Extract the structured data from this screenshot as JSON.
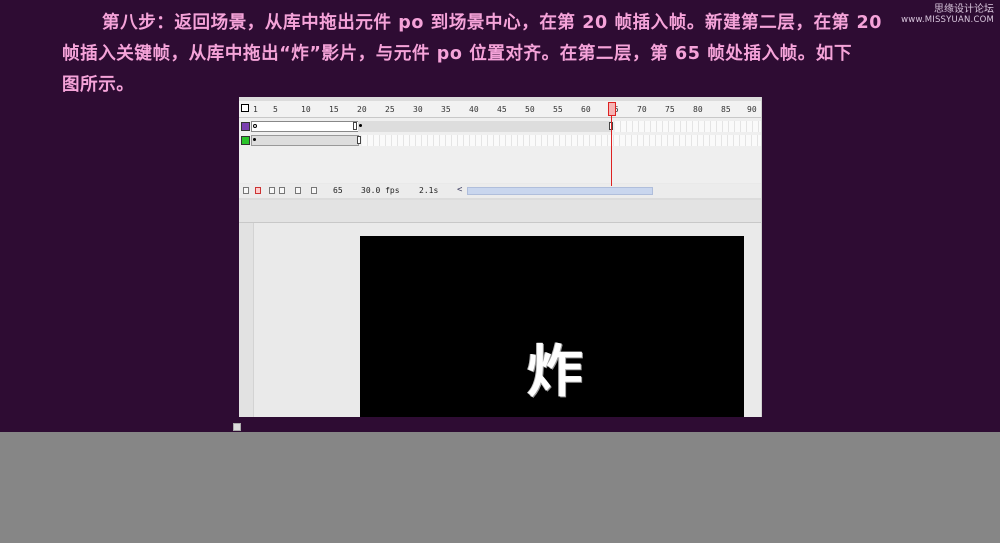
{
  "instructions": {
    "line1": "第八步：返回场景，从库中拖出元件 po 到场景中心，在第 20 帧插入帧。新建第二层，在第 20",
    "line2": "帧插入关键帧，从库中拖出“炸”影片，与元件 po 位置对齐。在第二层，第 65 帧处插入帧。如下",
    "line3": "图所示。"
  },
  "watermark": {
    "title": "思缘设计论坛",
    "url": "www.MISSYUAN.COM"
  },
  "timeline": {
    "ruler_ticks": [
      "1",
      "5",
      "10",
      "15",
      "20",
      "25",
      "30",
      "35",
      "40",
      "45",
      "50",
      "55",
      "60",
      "65",
      "70",
      "75",
      "80",
      "85",
      "90"
    ],
    "layers": [
      {
        "color": "#7a3fb0",
        "frames": 20
      },
      {
        "color": "#2bc42b",
        "frames": 65
      }
    ],
    "current_frame": "65",
    "frame_rate": "30.0 fps",
    "elapsed_time": "2.1s"
  },
  "stage": {
    "glyph": "炸"
  },
  "colors": {
    "background": "#2e0c33",
    "instruction_text": "#f5a3d9",
    "stage": "#000000",
    "playhead": "#dd2222"
  }
}
